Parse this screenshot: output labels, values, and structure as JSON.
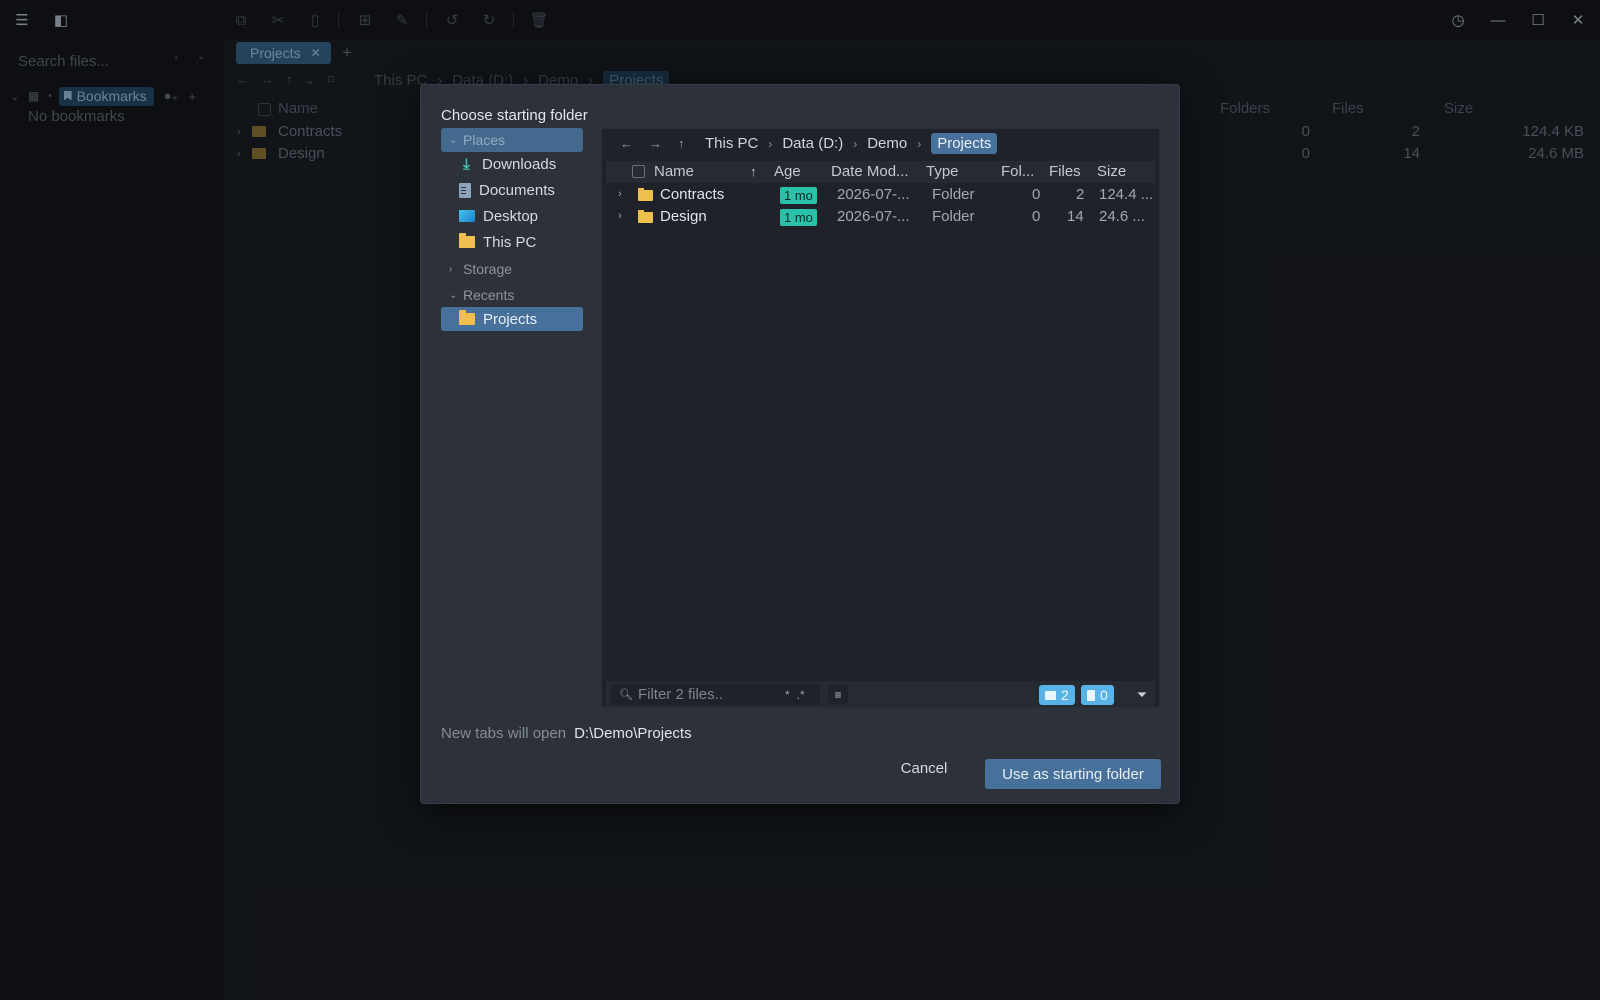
{
  "app": {
    "sidebar": {
      "search_placeholder": "Search files...",
      "bookmarks_label": "Bookmarks",
      "no_bookmarks": "No bookmarks"
    },
    "tab": {
      "label": "Projects"
    },
    "breadcrumbs": [
      "This PC",
      "Data (D:)",
      "Demo",
      "Projects"
    ],
    "columns": {
      "name": "Name",
      "folders": "Folders",
      "files": "Files",
      "size": "Size"
    },
    "rows": [
      {
        "name": "Contracts",
        "folders": "0",
        "files": "2",
        "size": "124.4 KB"
      },
      {
        "name": "Design",
        "folders": "0",
        "files": "14",
        "size": "24.6 MB"
      }
    ]
  },
  "dialog": {
    "title": "Choose starting folder",
    "places": {
      "section_places": "Places",
      "items": [
        {
          "label": "Downloads",
          "icon": "download-icon"
        },
        {
          "label": "Documents",
          "icon": "document-icon"
        },
        {
          "label": "Desktop",
          "icon": "desktop-icon"
        },
        {
          "label": "This PC",
          "icon": "folder-icon"
        }
      ],
      "section_storage": "Storage",
      "section_recents": "Recents",
      "recent_items": [
        {
          "label": "Projects",
          "icon": "folder-icon"
        }
      ]
    },
    "browser": {
      "breadcrumbs": [
        "This PC",
        "Data (D:)",
        "Demo",
        "Projects"
      ],
      "columns": {
        "name": "Name",
        "age": "Age",
        "date": "Date Mod...",
        "type": "Type",
        "folders": "Fol...",
        "files": "Files",
        "size": "Size"
      },
      "rows": [
        {
          "name": "Contracts",
          "age": "1 mo",
          "date": "2026-07-...",
          "type": "Folder",
          "folders": "0",
          "files": "2",
          "size": "124.4 ..."
        },
        {
          "name": "Design",
          "age": "1 mo",
          "date": "2026-07-...",
          "type": "Folder",
          "folders": "0",
          "files": "14",
          "size": "24.6 ..."
        }
      ],
      "filter_placeholder": "Filter 2 files..",
      "filter_glob": "*",
      "filter_regex": ".*",
      "folder_count": "2",
      "file_count": "0"
    },
    "status_label": "New tabs will open",
    "status_path": "D:\\Demo\\Projects",
    "cancel_label": "Cancel",
    "confirm_label": "Use as starting folder"
  },
  "colors": {
    "accent": "#47709a",
    "age_badge": "#2bc0a8",
    "count_badge": "#5ab3e6",
    "folder": "#efc04e"
  }
}
